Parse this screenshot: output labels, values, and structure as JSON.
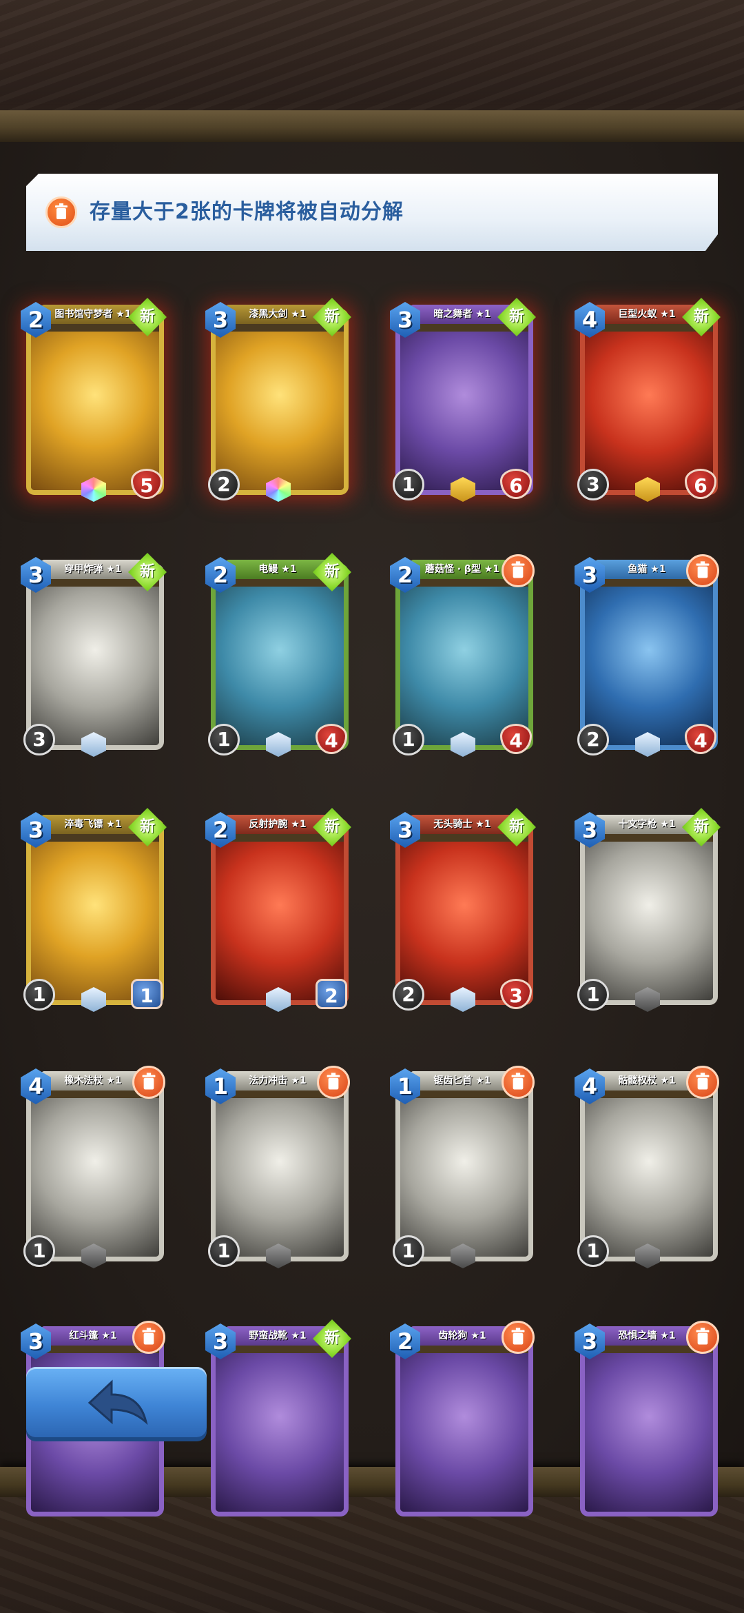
{
  "notice": {
    "icon": "trash-icon",
    "text": "存量大于2张的卡牌将被自动分解"
  },
  "badges": {
    "new_label": "新"
  },
  "cards": [
    {
      "name": "图书馆守梦者 ★1",
      "cost": "2",
      "attack": "",
      "health": "5",
      "badge": "new",
      "frame": "gold",
      "gem": "rainbow"
    },
    {
      "name": "漆黑大剑 ★1",
      "cost": "3",
      "attack": "2",
      "health": "",
      "badge": "new",
      "frame": "gold",
      "gem": "rainbow"
    },
    {
      "name": "暗之舞者 ★1",
      "cost": "3",
      "attack": "1",
      "health": "6",
      "badge": "new",
      "frame": "purple",
      "gem": "gold"
    },
    {
      "name": "巨型火蚁 ★1",
      "cost": "4",
      "attack": "3",
      "health": "6",
      "badge": "new",
      "frame": "red",
      "gem": "gold"
    },
    {
      "name": "穿甲炸弹 ★1",
      "cost": "3",
      "attack": "3",
      "health": "",
      "badge": "new",
      "frame": "gray",
      "gem": "ice"
    },
    {
      "name": "电鳗 ★1",
      "cost": "2",
      "attack": "1",
      "health": "4",
      "badge": "new",
      "frame": "green",
      "gem": "ice"
    },
    {
      "name": "蘑菇怪 · β型 ★1",
      "cost": "2",
      "attack": "1",
      "health": "4",
      "badge": "trash",
      "frame": "green",
      "gem": "ice"
    },
    {
      "name": "鱼猫 ★1",
      "cost": "3",
      "attack": "2",
      "health": "4",
      "badge": "trash",
      "frame": "blue",
      "gem": "ice"
    },
    {
      "name": "淬毒飞镖 ★1",
      "cost": "3",
      "attack": "1",
      "health": "1",
      "badge": "new",
      "frame": "gold",
      "gem": "ice",
      "hp_style": "blue"
    },
    {
      "name": "反射护腕 ★1",
      "cost": "2",
      "attack": "",
      "health": "2",
      "badge": "new",
      "frame": "red",
      "gem": "ice",
      "hp_style": "blue"
    },
    {
      "name": "无头骑士 ★1",
      "cost": "3",
      "attack": "2",
      "health": "3",
      "badge": "new",
      "frame": "red",
      "gem": "ice"
    },
    {
      "name": "十文字枪 ★1",
      "cost": "3",
      "attack": "1",
      "health": "",
      "badge": "new",
      "frame": "gray",
      "gem": "stone"
    },
    {
      "name": "橡木法杖 ★1",
      "cost": "4",
      "attack": "1",
      "health": "",
      "badge": "trash",
      "frame": "gray",
      "gem": "stone"
    },
    {
      "name": "法力冲击 ★1",
      "cost": "1",
      "attack": "1",
      "health": "",
      "badge": "trash",
      "frame": "gray",
      "gem": "stone"
    },
    {
      "name": "锯齿匕首 ★1",
      "cost": "1",
      "attack": "1",
      "health": "",
      "badge": "trash",
      "frame": "gray",
      "gem": "stone"
    },
    {
      "name": "骷髅权杖 ★1",
      "cost": "4",
      "attack": "1",
      "health": "",
      "badge": "trash",
      "frame": "gray",
      "gem": "stone"
    },
    {
      "name": "红斗篷 ★1",
      "cost": "3",
      "attack": "",
      "health": "",
      "badge": "trash",
      "frame": "purple",
      "gem": ""
    },
    {
      "name": "野蛮战靴 ★1",
      "cost": "3",
      "attack": "",
      "health": "",
      "badge": "new",
      "frame": "purple",
      "gem": ""
    },
    {
      "name": "齿轮狗 ★1",
      "cost": "2",
      "attack": "",
      "health": "",
      "badge": "trash",
      "frame": "purple",
      "gem": ""
    },
    {
      "name": "恐惧之墙 ★1",
      "cost": "3",
      "attack": "",
      "health": "",
      "badge": "trash",
      "frame": "purple",
      "gem": ""
    }
  ],
  "back_button": {
    "icon": "back-arrow-icon"
  },
  "colors": {
    "accent_blue": "#3f85d6",
    "notice_text": "#2a5e9e",
    "new_badge": "#8ad92c",
    "trash_badge": "#d94417"
  }
}
